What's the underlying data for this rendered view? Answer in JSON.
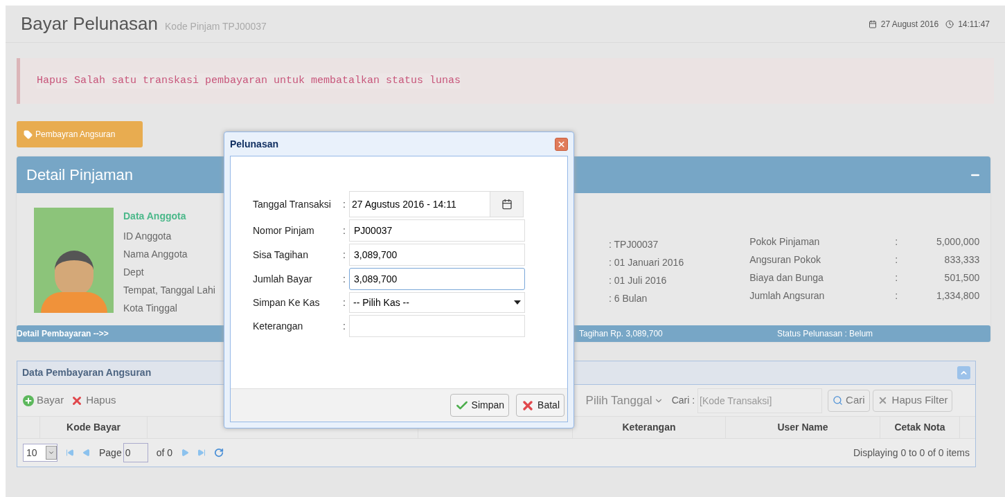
{
  "header": {
    "title": "Bayar Pelunasan",
    "subtitle": "Kode Pinjam TPJ00037",
    "date": "27 August 2016",
    "time": "14:11:47"
  },
  "alert": "Hapus Salah satu transkasi pembayaran untuk membatalkan status lunas",
  "action_button": "Pembayran Angsuran",
  "detail": {
    "title": "Detail Pinjaman",
    "member_heading": "Data Anggota",
    "member_fields": [
      "ID Anggota",
      "Nama Anggota",
      "Dept",
      "Tempat, Tanggal Lahi",
      "Kota Tinggal"
    ],
    "loan_values": [
      ": TPJ00037",
      ": 01 Januari 2016",
      ": 01 Juli 2016",
      ": 6 Bulan"
    ],
    "summary": [
      {
        "label": "Pokok Pinjaman",
        "separator": ":",
        "value": "5,000,000"
      },
      {
        "label": "Angsuran Pokok",
        "separator": ":",
        "value": "833,333"
      },
      {
        "label": "Biaya dan Bunga",
        "separator": ":",
        "value": "501,500"
      },
      {
        "label": "Jumlah Angsuran",
        "separator": ":",
        "value": "1,334,800"
      }
    ],
    "footer": {
      "link": "Detail Pembayaran -->>",
      "bill": "Tagihan Rp. 3,089,700",
      "status": "Status Pelunasan : Belum"
    }
  },
  "grid": {
    "title": "Data Pembayaran Angsuran",
    "toolbar": [
      {
        "kind": "add",
        "label": "Bayar"
      },
      {
        "kind": "delete",
        "label": "Hapus"
      }
    ],
    "date_filter": "Pilih Tanggal",
    "search_label": "Cari :",
    "search_placeholder": "[Kode Transaksi]",
    "search_button": "Cari",
    "clear_button": "Hapus Filter",
    "columns": [
      "Kode Bayar",
      "Keterangan",
      "User Name",
      "Cetak Nota"
    ],
    "pager": {
      "page_size": "10",
      "page_label": "Page",
      "page_value": "0",
      "page_total": "of 0",
      "display": "Displaying 0 to 0 of 0 items"
    }
  },
  "modal": {
    "title": "Pelunasan",
    "fields": [
      {
        "kind": "date",
        "label": "Tanggal Transaksi",
        "separator": ":",
        "value": "27 Agustus 2016 - 14:11",
        "focused": false
      },
      {
        "kind": "text",
        "label": "Nomor Pinjam",
        "separator": ":",
        "value": "PJ00037",
        "focused": false
      },
      {
        "kind": "text",
        "label": "Sisa Tagihan",
        "separator": ":",
        "value": "3,089,700",
        "focused": false
      },
      {
        "kind": "text",
        "label": "Jumlah Bayar",
        "separator": ":",
        "value": "3,089,700",
        "focused": true
      },
      {
        "kind": "select",
        "label": "Simpan Ke Kas",
        "separator": ":",
        "value": "-- Pilih Kas --",
        "focused": false
      },
      {
        "kind": "text",
        "label": "Keterangan",
        "separator": ":",
        "focused": false
      }
    ],
    "buttons": [
      {
        "kind": "save",
        "label": "Simpan"
      },
      {
        "kind": "cancel",
        "label": "Batal"
      }
    ]
  }
}
